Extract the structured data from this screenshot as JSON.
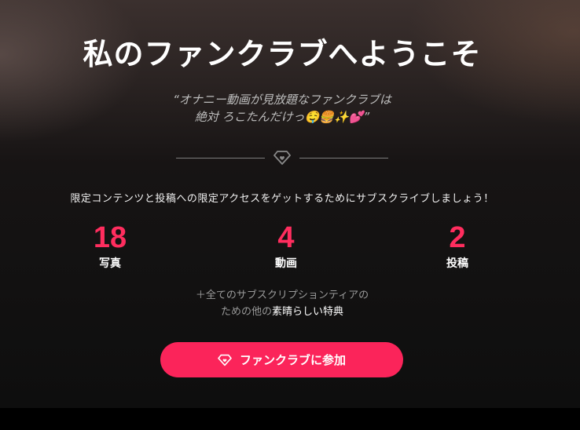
{
  "hero": {
    "title": "私のファンクラブへようこそ",
    "quote_line1": "“オナニー動画が見放題なファンクラブは",
    "quote_line2": "絶対 ろこたんだけっ🤤🍔✨💕”"
  },
  "subtitle": "限定コンテンツと投稿への限定アクセスをゲットするためにサブスクライブしましょう！",
  "stats": [
    {
      "value": "18",
      "label": "写真"
    },
    {
      "value": "4",
      "label": "動画"
    },
    {
      "value": "2",
      "label": "投稿"
    }
  ],
  "perks": {
    "line1": "＋全てのサブスクリプションティアの",
    "line2_prefix": "ための他の",
    "line2_highlight": "素晴らしい特典"
  },
  "join_button": {
    "label": "ファンクラブに参加",
    "icon": "diamond-heart-icon"
  },
  "colors": {
    "accent": "#fb245a",
    "stat_number": "#ff2d5e"
  }
}
